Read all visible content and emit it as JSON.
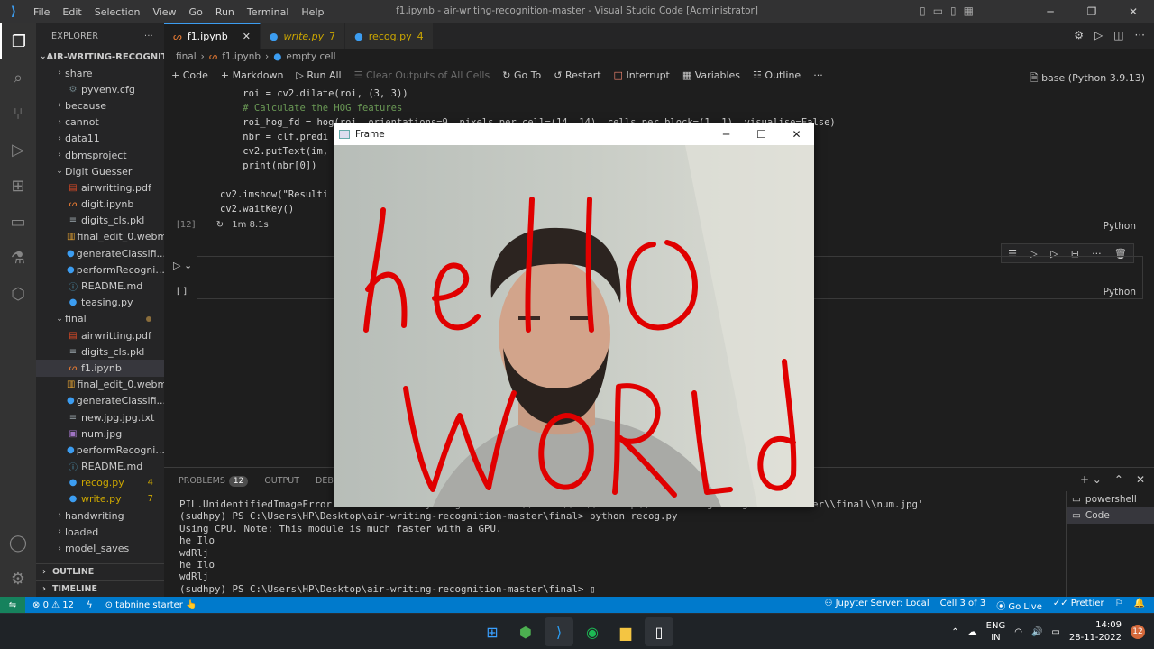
{
  "window": {
    "title": "f1.ipynb - air-writing-recognition-master - Visual Studio Code [Administrator]"
  },
  "menu": [
    "File",
    "Edit",
    "Selection",
    "View",
    "Go",
    "Run",
    "Terminal",
    "Help"
  ],
  "explorer": {
    "header": "EXPLORER",
    "more": "···",
    "project": "AIR-WRITING-RECOGNITI...",
    "items": [
      {
        "label": "share",
        "type": "folder",
        "indent": 1,
        "open": false
      },
      {
        "label": "pyvenv.cfg",
        "type": "cfg",
        "indent": 2
      },
      {
        "label": "because",
        "type": "folder",
        "indent": 1,
        "open": false
      },
      {
        "label": "cannot",
        "type": "folder",
        "indent": 1,
        "open": false
      },
      {
        "label": "data11",
        "type": "folder",
        "indent": 1,
        "open": false
      },
      {
        "label": "dbmsproject",
        "type": "folder",
        "indent": 1,
        "open": false
      },
      {
        "label": "Digit Guesser",
        "type": "folder",
        "indent": 1,
        "open": true
      },
      {
        "label": "airwritting.pdf",
        "type": "pdf",
        "indent": 2
      },
      {
        "label": "digit.ipynb",
        "type": "ipynb",
        "indent": 2
      },
      {
        "label": "digits_cls.pkl",
        "type": "pkl",
        "indent": 2
      },
      {
        "label": "final_edit_0.webm",
        "type": "video",
        "indent": 2
      },
      {
        "label": "generateClassifi...",
        "type": "py",
        "indent": 2
      },
      {
        "label": "performRecogni...",
        "type": "py",
        "indent": 2
      },
      {
        "label": "README.md",
        "type": "md",
        "indent": 2
      },
      {
        "label": "teasing.py",
        "type": "py",
        "indent": 2
      },
      {
        "label": "final",
        "type": "folder",
        "indent": 1,
        "open": true,
        "dot": true
      },
      {
        "label": "airwritting.pdf",
        "type": "pdf",
        "indent": 2
      },
      {
        "label": "digits_cls.pkl",
        "type": "pkl",
        "indent": 2
      },
      {
        "label": "f1.ipynb",
        "type": "ipynb",
        "indent": 2,
        "selected": true
      },
      {
        "label": "final_edit_0.webm",
        "type": "video",
        "indent": 2
      },
      {
        "label": "generateClassifi...",
        "type": "py",
        "indent": 2
      },
      {
        "label": "new.jpg.jpg.txt",
        "type": "txt",
        "indent": 2
      },
      {
        "label": "num.jpg",
        "type": "img",
        "indent": 2
      },
      {
        "label": "performRecogni...",
        "type": "py",
        "indent": 2
      },
      {
        "label": "README.md",
        "type": "md",
        "indent": 2
      },
      {
        "label": "recog.py",
        "type": "py",
        "indent": 2,
        "badge": "4",
        "warn": true
      },
      {
        "label": "write.py",
        "type": "py",
        "indent": 2,
        "badge": "7",
        "warn": true
      },
      {
        "label": "handwriting",
        "type": "folder",
        "indent": 1,
        "open": false
      },
      {
        "label": "loaded",
        "type": "folder",
        "indent": 1,
        "open": false
      },
      {
        "label": "model_saves",
        "type": "folder",
        "indent": 1,
        "open": false
      }
    ],
    "outline": "OUTLINE",
    "timeline": "TIMELINE"
  },
  "tabs": [
    {
      "label": "f1.ipynb",
      "active": true,
      "close": "✕"
    },
    {
      "label": "write.py",
      "badge": "7"
    },
    {
      "label": "recog.py",
      "badge": "4"
    }
  ],
  "breadcrumb": [
    "final",
    "f1.ipynb",
    "empty cell"
  ],
  "toolbar": {
    "code": "Code",
    "markdown": "Markdown",
    "run_all": "Run All",
    "clear": "Clear Outputs of All Cells",
    "goto": "Go To",
    "restart": "Restart",
    "interrupt": "Interrupt",
    "variables": "Variables",
    "outline": "Outline",
    "more": "···",
    "kernel": "base (Python 3.9.13)"
  },
  "code_lines": [
    "    roi = cv2.dilate(roi, (3, 3))",
    "    # Calculate the HOG features",
    "    roi_hog_fd = hog(roi, orientations=9, pixels_per_cell=(14, 14), cells_per_block=(1, 1), visualise=False)",
    "    nbr = clf.predi",
    "    cv2.putText(im,",
    "    print(nbr[0])",
    "",
    "cv2.imshow(\"Resulti",
    "cv2.waitKey()"
  ],
  "cell": {
    "exec_count": "[12]",
    "duration": "1m 8.1s",
    "lang": "Python",
    "empty_prompt": "[ ]"
  },
  "panel": {
    "problems": "PROBLEMS",
    "problems_count": "12",
    "output": "OUTPUT",
    "debug": "DEBUG"
  },
  "terminal_lines": [
    "PIL.UnidentifiedImageError: cannot identify image file 'C:\\\\Users\\\\HP\\\\Desktop\\\\air-writing-recognition-master\\\\final\\\\num.jpg'",
    "(sudhpy) PS C:\\Users\\HP\\Desktop\\air-writing-recognition-master\\final> python recog.py",
    "Using CPU. Note: This module is much faster with a GPU.",
    "he Ilo",
    "wdRlj",
    "he Ilo",
    "wdRlj",
    "(sudhpy) PS C:\\Users\\HP\\Desktop\\air-writing-recognition-master\\final> ▯"
  ],
  "terminals": [
    {
      "label": "powershell"
    },
    {
      "label": "Code",
      "active": true
    }
  ],
  "status": {
    "errors": "0",
    "warnings": "12",
    "tabnine": "tabnine starter",
    "jupyter": "Jupyter Server: Local",
    "cell": "Cell 3 of 3",
    "golive": "Go Live",
    "prettier": "Prettier"
  },
  "frame": {
    "title": "Frame",
    "drawn_text": [
      "hello",
      "WORld"
    ]
  },
  "taskbar": {
    "lang": "ENG",
    "region": "IN",
    "time": "14:09",
    "date": "28-11-2022",
    "notifications": "12"
  },
  "colors": {
    "accent": "#007acc",
    "ink": "#e00000",
    "warn": "#cca700"
  }
}
